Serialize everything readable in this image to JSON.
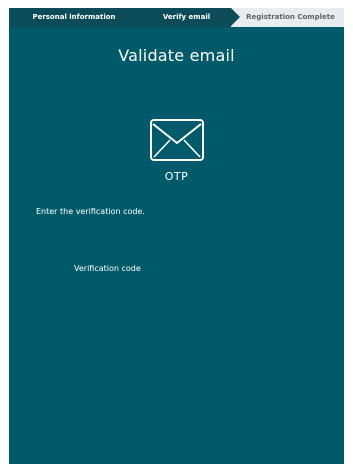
{
  "steps": [
    {
      "label": "Personal information"
    },
    {
      "label": "Verify email"
    },
    {
      "label": "Registration Complete"
    }
  ],
  "page": {
    "title": "Validate email",
    "icon_name": "envelope-icon",
    "icon_caption": "OTP",
    "instruction": "Enter the verification code.",
    "code_label": "Verification code",
    "code_value": ""
  },
  "colors": {
    "panel_bg": "#005a6a",
    "steps_active_bg": "#0b4c58",
    "steps_inactive_bg": "#e9ecee"
  }
}
